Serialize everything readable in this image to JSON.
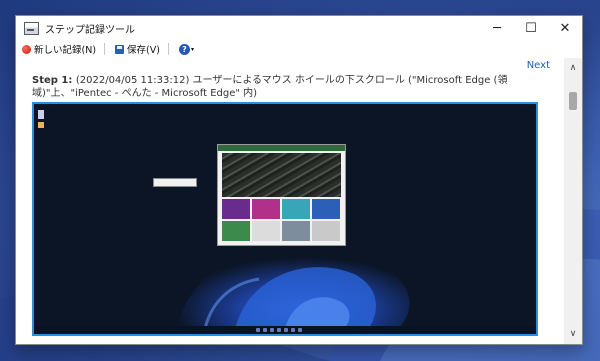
{
  "window": {
    "title": "ステップ記録ツール",
    "controls": {
      "minimize": "─",
      "maximize": "☐",
      "close": "✕"
    }
  },
  "toolbar": {
    "new_record_label": "新しい記録(N)",
    "save_label": "保存(V)",
    "help_label": "?",
    "dropdown_glyph": "▾"
  },
  "content": {
    "next_link": "Next",
    "step_number": "Step 1: ",
    "step_description": "(2022/04/05 11:33:12) ユーザーによるマウス ホイールの下スクロール (\"Microsoft Edge (領域)\"上、\"iPentec - ぺんた - Microsoft Edge\" 内)"
  },
  "scrollbar": {
    "up": "∧",
    "down": "∨"
  },
  "colors": {
    "accent_border": "#2a8fd8",
    "link": "#1a5fb4",
    "record_dot": "#c01a10"
  }
}
